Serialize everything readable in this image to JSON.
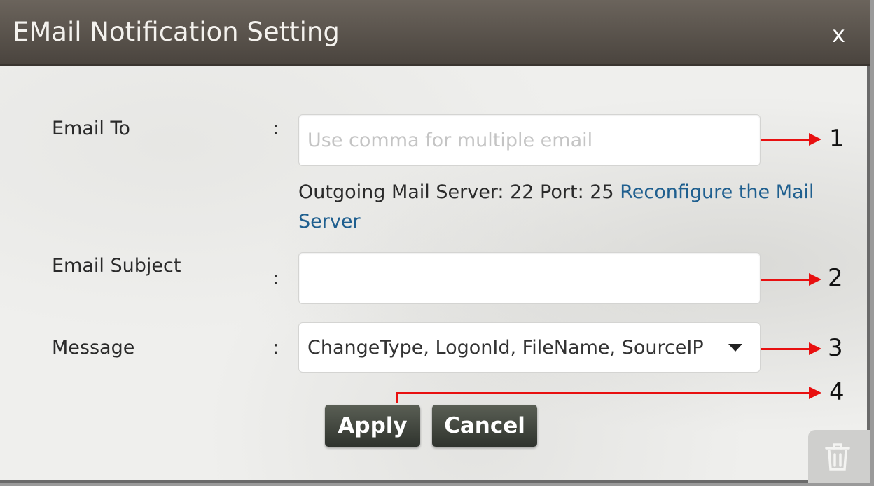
{
  "dialog": {
    "title": "EMail Notification Setting",
    "close_label": "x"
  },
  "form": {
    "email_to": {
      "label": "Email To",
      "colon": ":",
      "value": "",
      "placeholder": "Use comma for multiple email"
    },
    "server_info": {
      "text": "Outgoing Mail Server: 22  Port: 25 ",
      "link": "Reconfigure the Mail Server"
    },
    "email_subject": {
      "label": "Email Subject",
      "colon": ":",
      "value": ""
    },
    "message": {
      "label": "Message",
      "colon": ":",
      "selected": "ChangeType, LogonId, FileName, SourceIP"
    }
  },
  "buttons": {
    "apply": "Apply",
    "cancel": "Cancel"
  },
  "annotations": {
    "arrow_color": "#e81010",
    "labels": [
      "1",
      "2",
      "3",
      "4"
    ]
  },
  "icons": {
    "close": "close-icon",
    "dropdown": "chevron-down-icon",
    "trash": "trash-icon"
  }
}
